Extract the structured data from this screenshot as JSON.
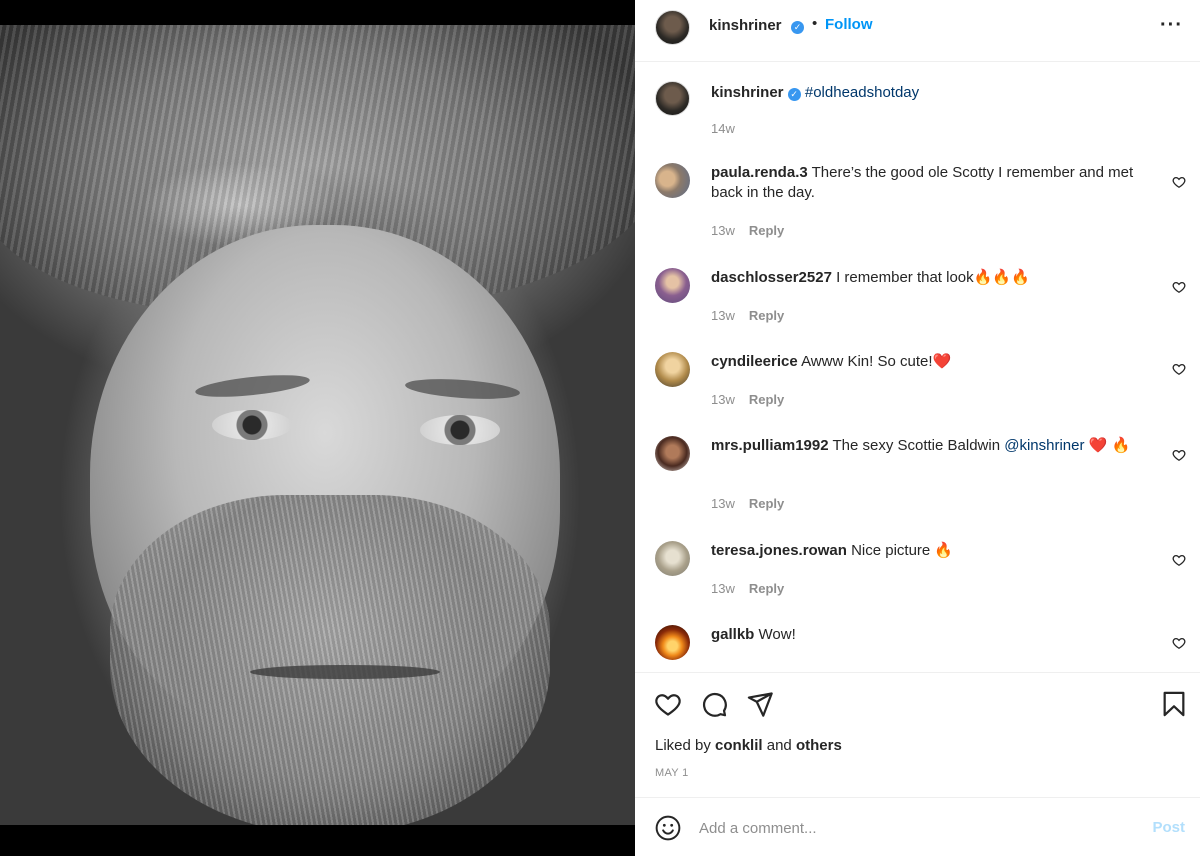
{
  "post": {
    "username": "kinshriner",
    "verified_mark": "✓",
    "separator": "•",
    "follow_label": "Follow",
    "more_label": "···",
    "photo_icon": "portrait-photo"
  },
  "caption": {
    "username": "kinshriner",
    "hashtag": "#oldheadshotday",
    "time": "14w"
  },
  "comments": [
    {
      "username": "paula.renda.3",
      "text": "There’s the good ole Scotty I remember and met back in the day.",
      "time": "13w",
      "reply_label": "Reply"
    },
    {
      "username": "daschlosser2527",
      "text": "I remember that look🔥🔥🔥",
      "time": "13w",
      "reply_label": "Reply"
    },
    {
      "username": "cyndileerice",
      "text": "Awww Kin! So cute!❤️",
      "time": "13w",
      "reply_label": "Reply"
    },
    {
      "username": "mrs.pulliam1992",
      "text": "The sexy Scottie Baldwin",
      "mention": "@kinshriner",
      "text_after": "❤️ 🔥",
      "time": "13w",
      "reply_label": "Reply"
    },
    {
      "username": "teresa.jones.rowan",
      "text": "Nice picture 🔥",
      "time": "13w",
      "reply_label": "Reply"
    },
    {
      "username": "gallkb",
      "text": "Wow!"
    }
  ],
  "likes": {
    "prefix": "Liked by",
    "user": "conklil",
    "and": "and",
    "others": "others"
  },
  "date": "MAY 1",
  "composer": {
    "placeholder": "Add a comment...",
    "post_label": "Post"
  },
  "colors": {
    "accent": "#0095f6",
    "verified": "#3897f0",
    "hashtag": "#00376b",
    "muted": "#8e8e8e",
    "post_disabled": "#b2dffc"
  }
}
